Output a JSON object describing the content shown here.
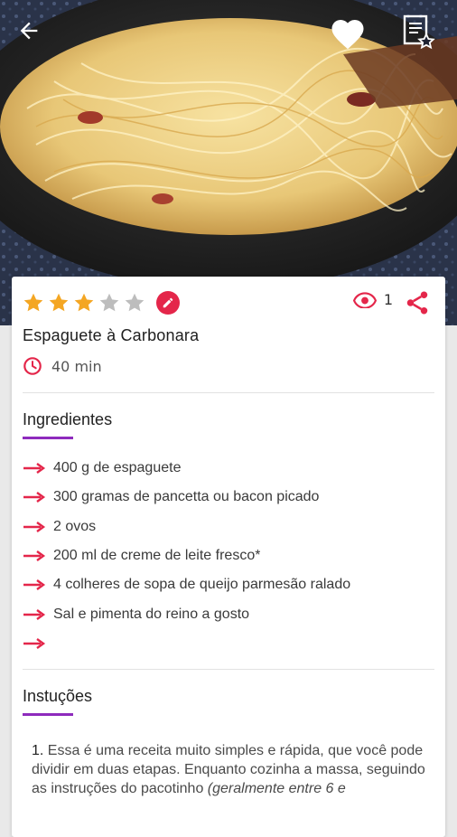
{
  "colors": {
    "accent_red": "#e4264a",
    "star_filled": "#f4a623",
    "star_empty": "#bdbdbd",
    "section_underline": "#8e2bbd"
  },
  "topbar": {
    "back_icon": "arrow-left-icon",
    "favorite_icon": "heart-icon",
    "recipe_list_icon": "recipe-book-star-icon"
  },
  "recipe": {
    "rating": 3,
    "rating_max": 5,
    "views": "1",
    "title": "Espaguete à Carbonara",
    "time": "40 min"
  },
  "ingredients": {
    "heading": "Ingredientes",
    "items": [
      "400 g de espaguete",
      "300 gramas de pancetta ou bacon picado",
      "2 ovos",
      "200 ml de creme de leite fresco*",
      "4 colheres de sopa de queijo parmesão ralado",
      "Sal e pimenta do reino a gosto",
      ""
    ]
  },
  "instructions": {
    "heading": "Instuções",
    "step_number": "1.",
    "step_text": " Essa é uma receita muito simples e rápida, que você pode dividir em duas etapas. Enquanto cozinha a massa, seguindo as instruções do pacotinho ",
    "step_italic": "(geralmente entre 6 e"
  }
}
